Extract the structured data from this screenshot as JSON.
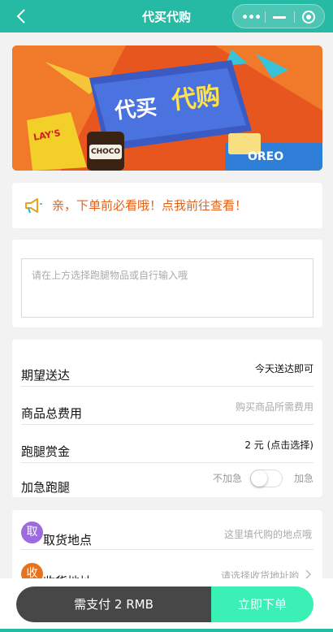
{
  "nav": {
    "title": "代买代购",
    "accent": "#26b9a4"
  },
  "notice": {
    "text": "亲，下单前必看哦！点我前往查看！"
  },
  "request": {
    "placeholder": "请在上方选择跑腿物品或自行输入哦"
  },
  "form": {
    "delivery": {
      "label": "期望送达",
      "value": "今天送达即可"
    },
    "cost": {
      "label": "商品总费用",
      "placeholder": "购买商品所需费用"
    },
    "reward": {
      "label": "跑腿赏金",
      "value": "2 元 (点击选择)"
    },
    "urgent": {
      "label": "加急跑腿",
      "off_label": "不加急",
      "on_label": "加急",
      "enabled": false
    }
  },
  "address": {
    "pickup": {
      "badge": "取",
      "label": "取货地点",
      "placeholder": "这里填代购的地点哦",
      "badge_color": "#9b6bdf"
    },
    "receive": {
      "badge": "收",
      "label": "收货地址",
      "placeholder": "请选择收货地址哟",
      "badge_color": "#e8731f"
    }
  },
  "footer": {
    "pay_label": "需支付 2 RMB",
    "order_label": "立即下单"
  },
  "banner": {
    "title_part1": "代买",
    "title_part2": "代购",
    "brand1": "LAY'S",
    "brand2": "CHOCO",
    "brand3": "OREO"
  }
}
